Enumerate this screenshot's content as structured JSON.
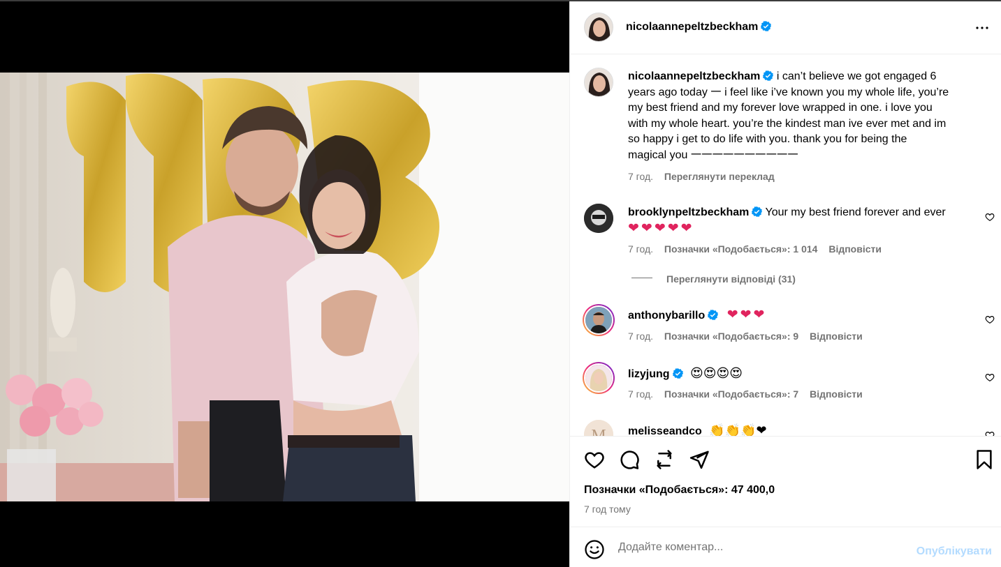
{
  "post": {
    "author": "nicolaannepeltzbeckham",
    "more_icon": "more-horizontal-icon",
    "caption": {
      "username": "nicolaannepeltzbeckham",
      "lines": [
        "i can’t believe we got engaged 6",
        "years ago today 𑁋 i feel like i’ve known you my whole life, you’re",
        "my best friend and my forever love wrapped in one. i love you",
        "with my whole heart. you’re the kindest man ive ever met and im",
        "so happy i get to do life with you. thank you for being the",
        "magical you 𑁋𑁋𑁋𑁋𑁋𑁋𑁋𑁋𑁋𑁋"
      ],
      "time": "7 год.",
      "translate": "Переглянути переклад"
    },
    "comments": [
      {
        "username": "brooklynpeltzbeckham",
        "verified": true,
        "text": "Your my best friend forever and ever",
        "emoji_line": "❤❤❤❤❤",
        "time": "7 год.",
        "likes": "Позначки «Подобається»: 1 014",
        "reply": "Відповісти",
        "view_replies": "Переглянути відповіді (31)"
      },
      {
        "username": "anthonybarillo",
        "verified": true,
        "text": "❤❤❤",
        "time": "7 год.",
        "likes": "Позначки «Подобається»: 9",
        "reply": "Відповісти"
      },
      {
        "username": "lizyjung",
        "verified": true,
        "text": "😍😍😍😍",
        "time": "7 год.",
        "likes": "Позначки «Подобається»: 7",
        "reply": "Відповісти"
      },
      {
        "username": "melisseandco",
        "verified": false,
        "text": "👏👏👏❤"
      }
    ],
    "likes_total": "Позначки «Подобається»: 47 400,0",
    "posted": "7 год тому",
    "composer": {
      "placeholder": "Додайте коментар...",
      "post_label": "Опублікувати"
    },
    "colors": {
      "verified": "#0095f6",
      "muted": "#737373",
      "post_button": "#b3dbff",
      "heart_red": "#e0245e"
    }
  }
}
